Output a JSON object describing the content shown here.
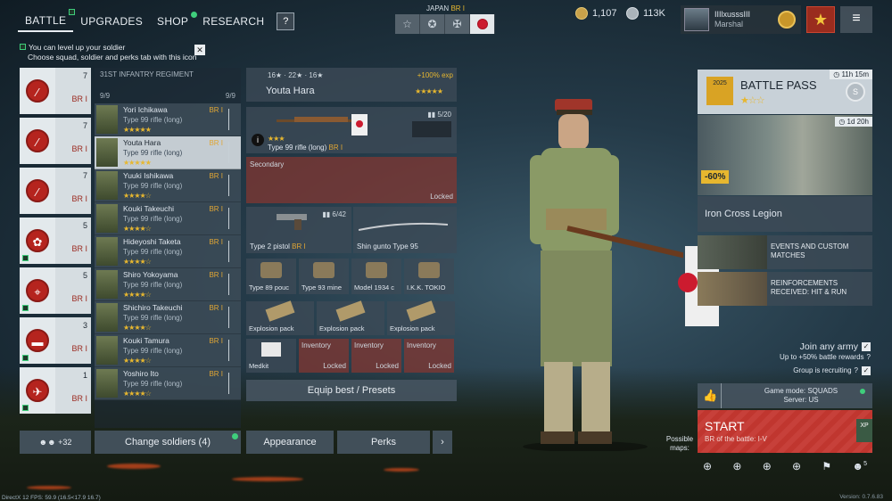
{
  "nav": {
    "tabs": [
      {
        "label": "BATTLE",
        "active": true
      },
      {
        "label": "UPGRADES"
      },
      {
        "label": "SHOP"
      },
      {
        "label": "RESEARCH"
      }
    ],
    "help": "?"
  },
  "hint": {
    "line1": "You can level up your soldier",
    "line2": "Choose squad, soldier and perks tab with this icon",
    "close": "✕"
  },
  "nation": {
    "name": "JAPAN",
    "br": "BR I"
  },
  "currency": {
    "silver": "1,107",
    "gold": "113K"
  },
  "profile": {
    "name": "IIIlxusssIII",
    "rank": "Marshal"
  },
  "squads": [
    {
      "count": "7",
      "br": "BR I"
    },
    {
      "count": "7",
      "br": "BR I"
    },
    {
      "count": "7",
      "br": "BR I"
    },
    {
      "count": "5",
      "br": "BR I"
    },
    {
      "count": "5",
      "br": "BR I"
    },
    {
      "count": "3",
      "br": "BR I"
    },
    {
      "count": "1",
      "br": "BR I"
    }
  ],
  "regiment": {
    "name": "31ST INFANTRY REGIMENT",
    "left": "9/9",
    "right": "9/9"
  },
  "soldiers": [
    {
      "name": "Yori Ichikawa",
      "weapon": "Type 99 rifle (long)",
      "stars": "★★★★★",
      "br": "BR I"
    },
    {
      "name": "Youta Hara",
      "weapon": "Type 99 rifle (long)",
      "stars": "★★★★★",
      "br": "BR I"
    },
    {
      "name": "Yuuki Ishikawa",
      "weapon": "Type 99 rifle (long)",
      "stars": "★★★★☆",
      "br": "BR I"
    },
    {
      "name": "Kouki Takeuchi",
      "weapon": "Type 99 rifle (long)",
      "stars": "★★★★☆",
      "br": "BR I"
    },
    {
      "name": "Hideyoshi Taketa",
      "weapon": "Type 99 rifle (long)",
      "stars": "★★★★☆",
      "br": "BR I"
    },
    {
      "name": "Shiro Yokoyama",
      "weapon": "Type 99 rifle (long)",
      "stars": "★★★★☆",
      "br": "BR I"
    },
    {
      "name": "Shichiro Takeuchi",
      "weapon": "Type 99 rifle (long)",
      "stars": "★★★★☆",
      "br": "BR I"
    },
    {
      "name": "Kouki Tamura",
      "weapon": "Type 99 rifle (long)",
      "stars": "★★★★☆",
      "br": "BR I"
    },
    {
      "name": "Yoshiro Ito",
      "weapon": "Type 99 rifle (long)",
      "stars": "★★★★☆",
      "br": "BR I"
    }
  ],
  "soldier_header": {
    "s1": "16",
    "s2": "22",
    "s3": "16",
    "exp": "+100% exp",
    "name": "Youta Hara",
    "stars": "★★★★★"
  },
  "primary": {
    "name": "Type 99 rifle (long)",
    "br": "BR I",
    "ammo": "5/20",
    "stars": "★★★"
  },
  "secondary": {
    "label": "Secondary",
    "locked": "Locked"
  },
  "pistol": {
    "name": "Type 2 pistol",
    "br": "BR I",
    "ammo": "6/42"
  },
  "melee": {
    "name": "Shin gunto Type 95"
  },
  "items1": [
    "Type 89 pouc",
    "Type 93 mine",
    "Model 1934 c",
    "I.K.K. TOKIO"
  ],
  "items2": [
    "Explosion pack",
    "Explosion pack",
    "Explosion pack"
  ],
  "items3": [
    {
      "name": "Medkit"
    },
    {
      "label": "Inventory",
      "locked": "Locked"
    },
    {
      "label": "Inventory",
      "locked": "Locked"
    },
    {
      "label": "Inventory",
      "locked": "Locked"
    }
  ],
  "buttons": {
    "equip": "Equip best / Presets",
    "reserve": "+32",
    "change": "Change soldiers (4)",
    "appearance": "Appearance",
    "perks": "Perks",
    "next": "›"
  },
  "battlepass": {
    "title": "BATTLE PASS",
    "stars": "★☆☆",
    "timer": "11h 15m",
    "event_timer": "1d 20h",
    "discount": "-60%",
    "event_name": "Iron Cross Legion",
    "year": "2025"
  },
  "events": [
    {
      "title": "EVENTS AND CUSTOM MATCHES"
    },
    {
      "title": "REINFORCEMENTS RECEIVED: HIT & RUN"
    }
  ],
  "options": {
    "join": "Join any army",
    "join_sub": "Up to +50% battle rewards",
    "recruiting": "Group is recruiting"
  },
  "gamemode": {
    "mode": "Game mode: SQUADS",
    "server": "Server: US"
  },
  "start": {
    "label": "START",
    "br": "BR of the battle:  I-V"
  },
  "possible_maps": "Possible maps:",
  "party_count": "5",
  "fps": "DirectX 12 FPS: 59.9 (16.5<17.9 16.7)",
  "version": "Version: 0.7.6.83",
  "colors": {
    "accent": "#e7b72f",
    "start": "#c7403a",
    "japan": "#cc1b2f",
    "online": "#3fce7c"
  }
}
